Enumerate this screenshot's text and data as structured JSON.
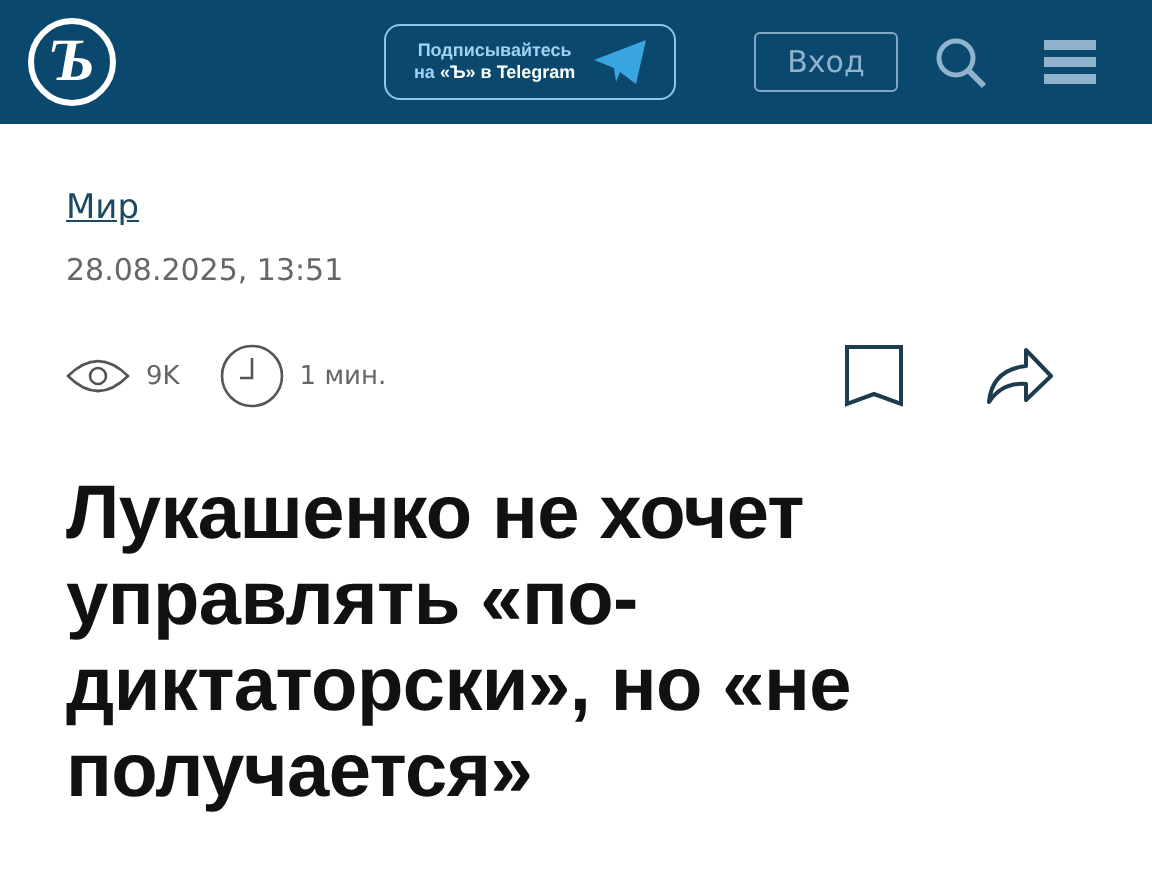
{
  "header": {
    "logo": "Ъ",
    "promo": {
      "line_1": "Подписывайтесь",
      "line_2": "на **«Ъ» в Telegram**"
    },
    "login": "Вход"
  },
  "article": {
    "rubric": "Мир",
    "date": "28.08.2025, 13:51",
    "views": "9K",
    "read_time": "1 мин.",
    "title": "Лукашенко не хочет управлять «по-диктаторски», но «не получается»"
  }
}
